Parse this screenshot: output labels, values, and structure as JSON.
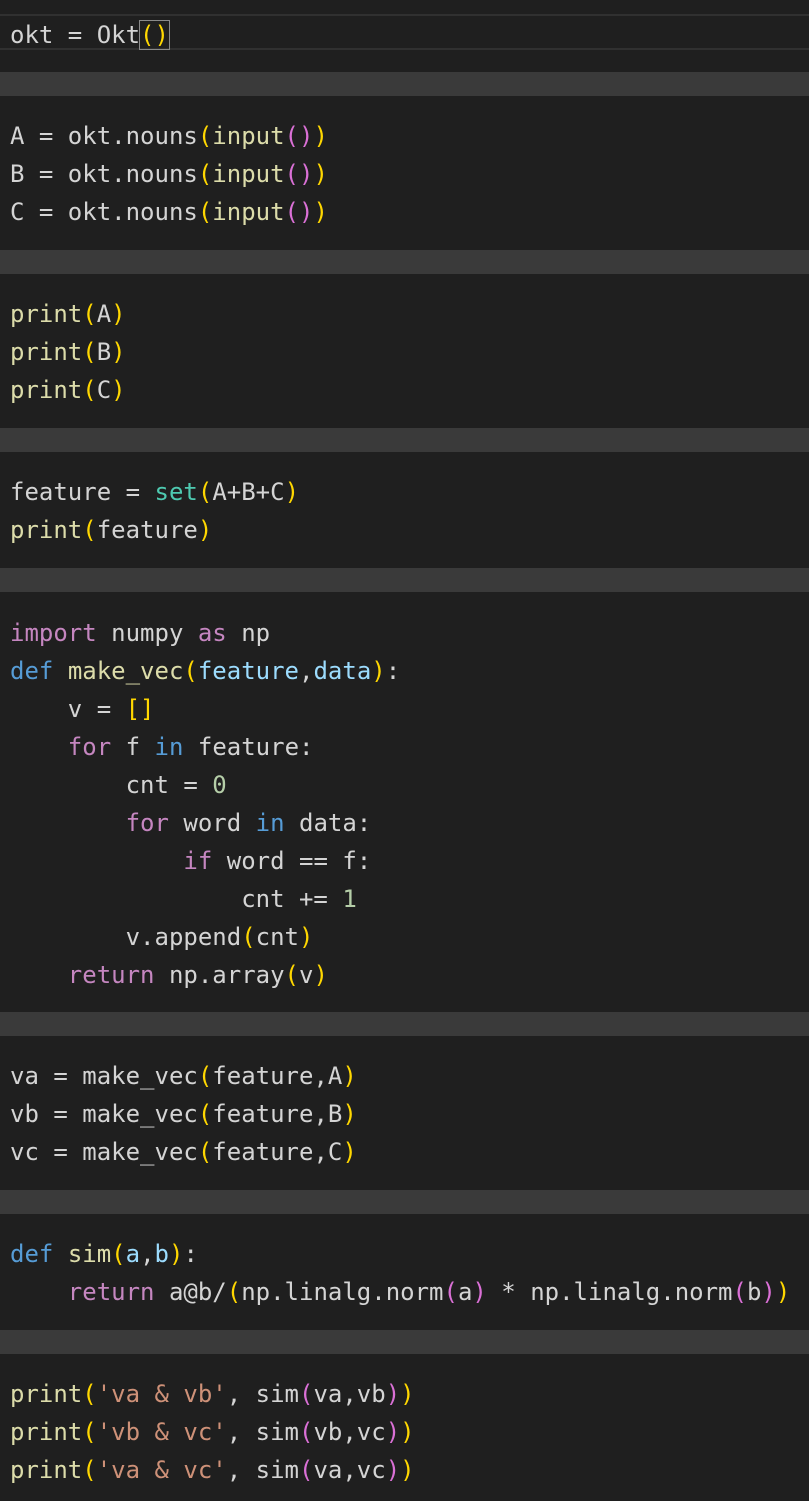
{
  "theme": {
    "gap_color": "#3a3a3a",
    "cell_bg": "#1f1f1f",
    "default_text": "#d4d4d4",
    "function": "#dcdcaa",
    "keyword": "#c586c0",
    "def_keyword": "#569cd6",
    "builtin": "#4ec9b0",
    "parameter": "#9cdcfe",
    "string": "#ce9178",
    "number": "#b5cea8",
    "bracket_level1": "#ffd700",
    "bracket_level2": "#da70d6"
  },
  "cells": [
    {
      "name": "cell-okt-init",
      "lines": [
        [
          [
            "default",
            "okt = Okt"
          ],
          [
            "bracket1-cursor",
            "()"
          ]
        ]
      ]
    },
    {
      "name": "cell-nouns-input",
      "lines": [
        [
          [
            "default",
            "A = okt.nouns"
          ],
          [
            "bracket1",
            "("
          ],
          [
            "func",
            "input"
          ],
          [
            "bracket2",
            "()"
          ],
          [
            "bracket1",
            ")"
          ]
        ],
        [
          [
            "default",
            "B = okt.nouns"
          ],
          [
            "bracket1",
            "("
          ],
          [
            "func",
            "input"
          ],
          [
            "bracket2",
            "()"
          ],
          [
            "bracket1",
            ")"
          ]
        ],
        [
          [
            "default",
            "C = okt.nouns"
          ],
          [
            "bracket1",
            "("
          ],
          [
            "func",
            "input"
          ],
          [
            "bracket2",
            "()"
          ],
          [
            "bracket1",
            ")"
          ]
        ]
      ]
    },
    {
      "name": "cell-print-abc",
      "lines": [
        [
          [
            "func",
            "print"
          ],
          [
            "bracket1",
            "("
          ],
          [
            "default",
            "A"
          ],
          [
            "bracket1",
            ")"
          ]
        ],
        [
          [
            "func",
            "print"
          ],
          [
            "bracket1",
            "("
          ],
          [
            "default",
            "B"
          ],
          [
            "bracket1",
            ")"
          ]
        ],
        [
          [
            "func",
            "print"
          ],
          [
            "bracket1",
            "("
          ],
          [
            "default",
            "C"
          ],
          [
            "bracket1",
            ")"
          ]
        ]
      ]
    },
    {
      "name": "cell-feature-set",
      "lines": [
        [
          [
            "default",
            "feature = "
          ],
          [
            "builtin",
            "set"
          ],
          [
            "bracket1",
            "("
          ],
          [
            "default",
            "A+B+C"
          ],
          [
            "bracket1",
            ")"
          ]
        ],
        [
          [
            "func",
            "print"
          ],
          [
            "bracket1",
            "("
          ],
          [
            "default",
            "feature"
          ],
          [
            "bracket1",
            ")"
          ]
        ]
      ]
    },
    {
      "name": "cell-make-vec",
      "lines": [
        [
          [
            "kw",
            "import"
          ],
          [
            "default",
            " numpy "
          ],
          [
            "kw",
            "as"
          ],
          [
            "default",
            " np"
          ]
        ],
        [
          [
            "def",
            "def"
          ],
          [
            "default",
            " "
          ],
          [
            "func",
            "make_vec"
          ],
          [
            "bracket1",
            "("
          ],
          [
            "param",
            "feature"
          ],
          [
            "default",
            ","
          ],
          [
            "param",
            "data"
          ],
          [
            "bracket1",
            ")"
          ],
          [
            "default",
            ":"
          ]
        ],
        [
          [
            "default",
            "    v = "
          ],
          [
            "bracket1",
            "[]"
          ]
        ],
        [
          [
            "default",
            "    "
          ],
          [
            "kw",
            "for"
          ],
          [
            "default",
            " f "
          ],
          [
            "def",
            "in"
          ],
          [
            "default",
            " feature:"
          ]
        ],
        [
          [
            "default",
            "        cnt = "
          ],
          [
            "number",
            "0"
          ]
        ],
        [
          [
            "default",
            "        "
          ],
          [
            "kw",
            "for"
          ],
          [
            "default",
            " word "
          ],
          [
            "def",
            "in"
          ],
          [
            "default",
            " data:"
          ]
        ],
        [
          [
            "default",
            "            "
          ],
          [
            "kw",
            "if"
          ],
          [
            "default",
            " word == f:"
          ]
        ],
        [
          [
            "default",
            "                cnt += "
          ],
          [
            "number",
            "1"
          ]
        ],
        [
          [
            "default",
            "        v.append"
          ],
          [
            "bracket1",
            "("
          ],
          [
            "default",
            "cnt"
          ],
          [
            "bracket1",
            ")"
          ]
        ],
        [
          [
            "default",
            "    "
          ],
          [
            "kw",
            "return"
          ],
          [
            "default",
            " np.array"
          ],
          [
            "bracket1",
            "("
          ],
          [
            "default",
            "v"
          ],
          [
            "bracket1",
            ")"
          ]
        ]
      ]
    },
    {
      "name": "cell-make-vectors",
      "lines": [
        [
          [
            "default",
            "va = make_vec"
          ],
          [
            "bracket1",
            "("
          ],
          [
            "default",
            "feature,A"
          ],
          [
            "bracket1",
            ")"
          ]
        ],
        [
          [
            "default",
            "vb = make_vec"
          ],
          [
            "bracket1",
            "("
          ],
          [
            "default",
            "feature,B"
          ],
          [
            "bracket1",
            ")"
          ]
        ],
        [
          [
            "default",
            "vc = make_vec"
          ],
          [
            "bracket1",
            "("
          ],
          [
            "default",
            "feature,C"
          ],
          [
            "bracket1",
            ")"
          ]
        ]
      ]
    },
    {
      "name": "cell-sim-def",
      "lines": [
        [
          [
            "def",
            "def"
          ],
          [
            "default",
            " "
          ],
          [
            "func",
            "sim"
          ],
          [
            "bracket1",
            "("
          ],
          [
            "param",
            "a"
          ],
          [
            "default",
            ","
          ],
          [
            "param",
            "b"
          ],
          [
            "bracket1",
            ")"
          ],
          [
            "default",
            ":"
          ]
        ],
        [
          [
            "default",
            "    "
          ],
          [
            "kw",
            "return"
          ],
          [
            "default",
            " a@b/"
          ],
          [
            "bracket1",
            "("
          ],
          [
            "default",
            "np.linalg.norm"
          ],
          [
            "bracket2",
            "("
          ],
          [
            "default",
            "a"
          ],
          [
            "bracket2",
            ")"
          ],
          [
            "default",
            " * np.linalg.norm"
          ],
          [
            "bracket2",
            "("
          ],
          [
            "default",
            "b"
          ],
          [
            "bracket2",
            ")"
          ],
          [
            "bracket1",
            ")"
          ]
        ]
      ]
    },
    {
      "name": "cell-print-sim",
      "lines": [
        [
          [
            "func",
            "print"
          ],
          [
            "bracket1",
            "("
          ],
          [
            "string",
            "'va & vb'"
          ],
          [
            "default",
            ", sim"
          ],
          [
            "bracket2",
            "("
          ],
          [
            "default",
            "va,vb"
          ],
          [
            "bracket2",
            ")"
          ],
          [
            "bracket1",
            ")"
          ]
        ],
        [
          [
            "func",
            "print"
          ],
          [
            "bracket1",
            "("
          ],
          [
            "string",
            "'vb & vc'"
          ],
          [
            "default",
            ", sim"
          ],
          [
            "bracket2",
            "("
          ],
          [
            "default",
            "vb,vc"
          ],
          [
            "bracket2",
            ")"
          ],
          [
            "bracket1",
            ")"
          ]
        ],
        [
          [
            "func",
            "print"
          ],
          [
            "bracket1",
            "("
          ],
          [
            "string",
            "'va & vc'"
          ],
          [
            "default",
            ", sim"
          ],
          [
            "bracket2",
            "("
          ],
          [
            "default",
            "va,vc"
          ],
          [
            "bracket2",
            ")"
          ],
          [
            "bracket1",
            ")"
          ]
        ]
      ]
    }
  ]
}
